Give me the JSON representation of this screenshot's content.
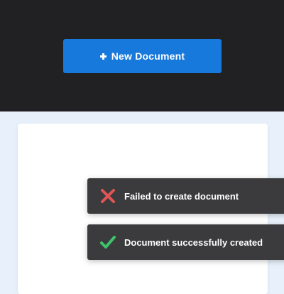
{
  "header": {
    "new_document_label": "New Document"
  },
  "toasts": [
    {
      "type": "error",
      "message": "Failed to create document",
      "icon": "x-icon",
      "color": "#e05555"
    },
    {
      "type": "success",
      "message": "Document successfully created",
      "icon": "check-icon",
      "color": "#3ec46d"
    }
  ],
  "colors": {
    "header_bg": "#212123",
    "accent": "#1879dc",
    "page_bg": "#e8f1fb",
    "toast_bg": "#3b3b3d"
  }
}
